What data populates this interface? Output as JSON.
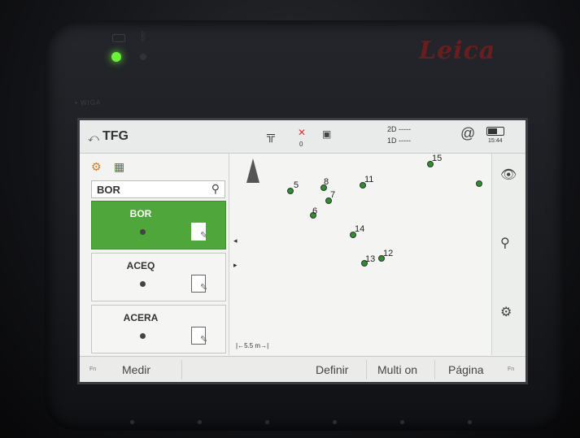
{
  "device": {
    "brand": "Leica",
    "model_label": "• WIGA"
  },
  "header": {
    "title": "TFG",
    "quality_2d": "2D -----",
    "quality_1d": "1D -----",
    "gnss_count": "0",
    "time": "15:44"
  },
  "search": {
    "value": "BOR"
  },
  "codes": [
    {
      "label": "BOR",
      "selected": true
    },
    {
      "label": "ACEQ",
      "selected": false
    },
    {
      "label": "ACERA",
      "selected": false
    }
  ],
  "map": {
    "points": [
      "5",
      "6",
      "7",
      "8",
      "11",
      "12",
      "13",
      "14",
      "15"
    ],
    "scale_label": "|←5.5 m→|"
  },
  "softkeys": {
    "fn_left": "Fn",
    "medir": "Medir",
    "definir": "Definir",
    "multi_on": "Multi on",
    "pagina": "Página",
    "fn_right": "Fn"
  },
  "icons": [
    "back-icon",
    "instrument-icon",
    "gnss-icon",
    "phone-icon",
    "at-icon",
    "battery-icon",
    "code-tools-icon",
    "search-icon",
    "north-arrow-icon",
    "eye-icon",
    "zoom-icon",
    "settings-icon"
  ],
  "colors": {
    "selected_green": "#4fa63a",
    "point_green": "#2d8f2d",
    "brand_red": "#7a1d1d"
  }
}
